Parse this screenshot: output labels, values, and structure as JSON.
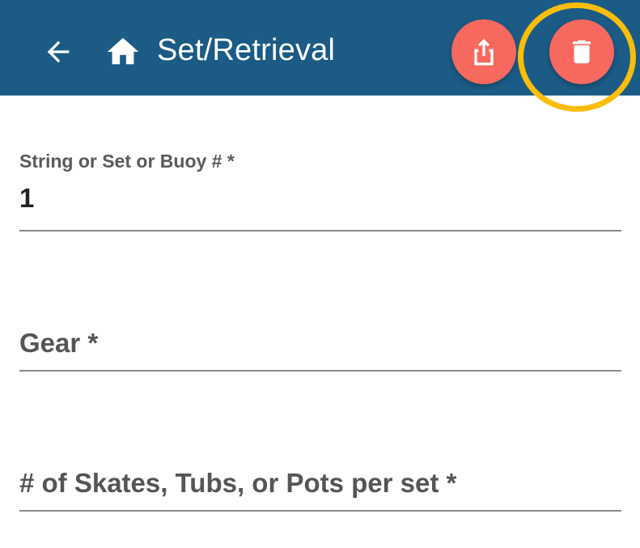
{
  "header": {
    "title": "Set/Retrieval",
    "background_color": "#1b5b85",
    "back_icon": "arrow-left-icon",
    "home_icon": "home-icon"
  },
  "actions": {
    "share_icon": "share-icon",
    "delete_icon": "trash-icon",
    "fab_color": "#f7685f",
    "highlight_color": "#fbbd08",
    "highlighted_action": "delete"
  },
  "form": {
    "string_field": {
      "label": "String or Set or Buoy # *",
      "value": "1"
    },
    "gear_field": {
      "label": "Gear *",
      "value": ""
    },
    "skates_field": {
      "label": "# of Skates, Tubs, or Pots per set *",
      "value": ""
    }
  }
}
